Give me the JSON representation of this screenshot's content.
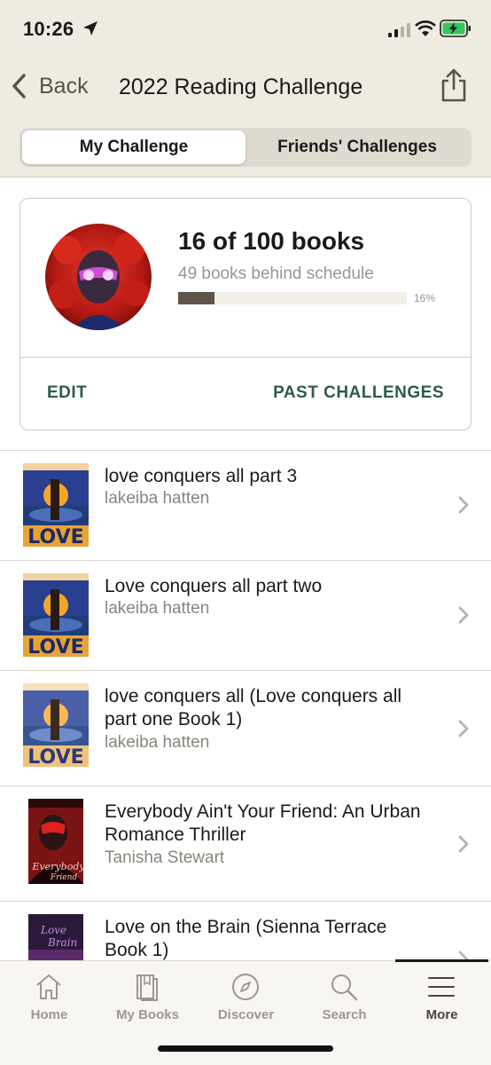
{
  "status_bar": {
    "time": "10:26"
  },
  "nav": {
    "back_label": "Back",
    "title": "2022 Reading Challenge"
  },
  "segments": {
    "my": "My Challenge",
    "friends": "Friends' Challenges"
  },
  "challenge": {
    "count": "16 of 100 books",
    "status": "49 books behind schedule",
    "percent_text": "16%",
    "progress_fraction": 0.16,
    "edit_label": "EDIT",
    "past_label": "PAST CHALLENGES"
  },
  "books": [
    {
      "title": "love conquers all part 3",
      "author": "lakeiba hatten",
      "cover": "love-conquers-cover"
    },
    {
      "title": "Love conquers all part two",
      "author": "lakeiba hatten",
      "cover": "love-conquers-cover"
    },
    {
      "title": "love conquers all (Love conquers all part one Book 1)",
      "author": "lakeiba hatten",
      "cover": "love-conquers-cover"
    },
    {
      "title": "Everybody Ain't Your Friend: An Urban Romance Thriller",
      "author": "Tanisha Stewart",
      "cover": "everybody-cover"
    },
    {
      "title": "Love on the Brain (Sienna Terrace Book 1)",
      "author": "",
      "cover": "love-brain-cover"
    }
  ],
  "tabs": {
    "home": "Home",
    "mybooks": "My Books",
    "discover": "Discover",
    "search": "Search",
    "more": "More"
  },
  "colors": {
    "accent": "#2f5a4f",
    "header_bg": "#eeebe0",
    "progress": "#5e5449"
  }
}
